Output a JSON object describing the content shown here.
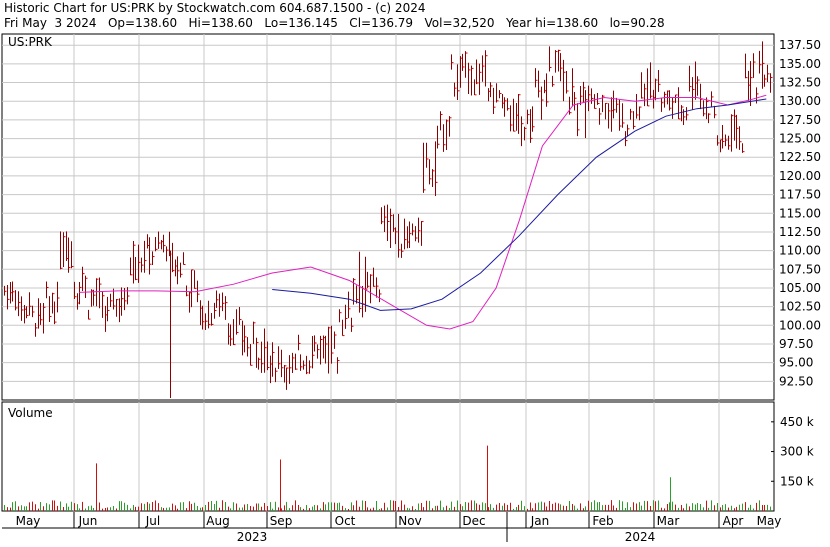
{
  "header": {
    "line1": "Historic Chart for US:PRK by Stockwatch.com 604.687.1500 - (c) 2024",
    "line2": "Fri May  3 2024   Op=138.60   Hi=138.60   Lo=136.145   Cl=136.79   Vol=32,520   Year hi=138.60   lo=90.28"
  },
  "chart_data": [
    {
      "type": "bar",
      "subtype": "ohlc",
      "symbol_label": "US:PRK",
      "y_ticks": [
        "137.50",
        "135.00",
        "132.50",
        "130.00",
        "127.50",
        "125.00",
        "122.50",
        "120.00",
        "117.50",
        "115.00",
        "112.50",
        "110.00",
        "107.50",
        "105.00",
        "102.50",
        "100.00",
        "97.50",
        "95.00",
        "92.50"
      ],
      "ylim": [
        90.0,
        139.0
      ],
      "y_axis_side": "right",
      "grid": true,
      "x_ticks": [
        "May",
        "Jun",
        "Jul",
        "Aug",
        "Sep",
        "Oct",
        "Nov",
        "Dec",
        "Jan",
        "Feb",
        "Mar",
        "Apr",
        "May"
      ],
      "x_years": [
        "2023",
        "2024"
      ],
      "colors": {
        "bar": "#8b0000",
        "tick": "#cc0000",
        "ma_short": "#e020c0",
        "ma_long": "#1a1aa0",
        "grid": "#c8c8c8"
      },
      "weekly_ranges": [
        [
          103,
          106
        ],
        [
          100,
          104
        ],
        [
          99,
          103
        ],
        [
          101,
          105
        ],
        [
          108,
          113
        ],
        [
          103,
          108
        ],
        [
          101,
          106
        ],
        [
          100,
          104
        ],
        [
          101,
          105
        ],
        [
          106,
          112
        ],
        [
          107,
          112
        ],
        [
          109,
          112
        ],
        [
          106,
          111
        ],
        [
          102,
          107
        ],
        [
          100,
          103
        ],
        [
          101,
          104
        ],
        [
          98,
          102
        ],
        [
          95,
          100
        ],
        [
          94,
          99
        ],
        [
          93,
          97
        ],
        [
          92,
          96
        ],
        [
          94,
          98
        ],
        [
          95,
          99
        ],
        [
          94,
          99
        ],
        [
          99,
          104
        ],
        [
          101,
          109
        ],
        [
          103,
          107
        ],
        [
          111,
          116
        ],
        [
          110,
          114
        ],
        [
          111,
          114
        ],
        [
          118,
          124
        ],
        [
          124,
          128
        ],
        [
          130,
          136
        ],
        [
          131,
          136
        ],
        [
          131,
          136
        ],
        [
          128,
          132
        ],
        [
          126,
          130
        ],
        [
          125,
          129
        ],
        [
          128,
          134
        ],
        [
          132,
          137
        ],
        [
          129,
          135
        ],
        [
          126,
          132
        ],
        [
          127,
          131
        ],
        [
          126,
          131
        ],
        [
          125,
          130
        ],
        [
          127,
          133
        ],
        [
          130,
          135
        ],
        [
          128,
          132
        ],
        [
          127,
          131
        ],
        [
          129,
          136
        ],
        [
          127,
          131
        ],
        [
          123,
          126
        ],
        [
          123,
          128
        ],
        [
          130,
          136
        ],
        [
          132,
          137
        ]
      ],
      "ma_short": [
        [
          0.1,
          104.4
        ],
        [
          0.15,
          104.6
        ],
        [
          0.2,
          104.6
        ],
        [
          0.25,
          104.5
        ],
        [
          0.3,
          105.5
        ],
        [
          0.35,
          107.0
        ],
        [
          0.4,
          107.8
        ],
        [
          0.45,
          106.0
        ],
        [
          0.5,
          103.0
        ],
        [
          0.55,
          100.0
        ],
        [
          0.58,
          99.5
        ],
        [
          0.61,
          100.5
        ],
        [
          0.64,
          105.0
        ],
        [
          0.67,
          114.0
        ],
        [
          0.7,
          124.0
        ],
        [
          0.74,
          129.5
        ],
        [
          0.78,
          130.5
        ],
        [
          0.82,
          130.0
        ],
        [
          0.86,
          130.5
        ],
        [
          0.9,
          130.5
        ],
        [
          0.94,
          129.5
        ],
        [
          0.97,
          130.2
        ],
        [
          0.99,
          130.8
        ]
      ],
      "ma_long": [
        [
          0.35,
          104.8
        ],
        [
          0.4,
          104.3
        ],
        [
          0.45,
          103.5
        ],
        [
          0.49,
          102.0
        ],
        [
          0.53,
          102.2
        ],
        [
          0.57,
          103.5
        ],
        [
          0.62,
          107.0
        ],
        [
          0.67,
          112.0
        ],
        [
          0.72,
          117.5
        ],
        [
          0.77,
          122.5
        ],
        [
          0.82,
          126.0
        ],
        [
          0.86,
          128.0
        ],
        [
          0.9,
          129.0
        ],
        [
          0.94,
          129.5
        ],
        [
          0.99,
          130.3
        ]
      ]
    },
    {
      "type": "bar",
      "title": "Volume",
      "y_ticks": [
        "450 k",
        "300 k",
        "150 k"
      ],
      "ylim": [
        0,
        550000
      ],
      "spikes": [
        {
          "pos": 0.12,
          "value": 240000
        },
        {
          "pos": 0.36,
          "value": 260000
        },
        {
          "pos": 0.63,
          "value": 330000
        },
        {
          "pos": 0.87,
          "value": 170000
        }
      ]
    }
  ]
}
